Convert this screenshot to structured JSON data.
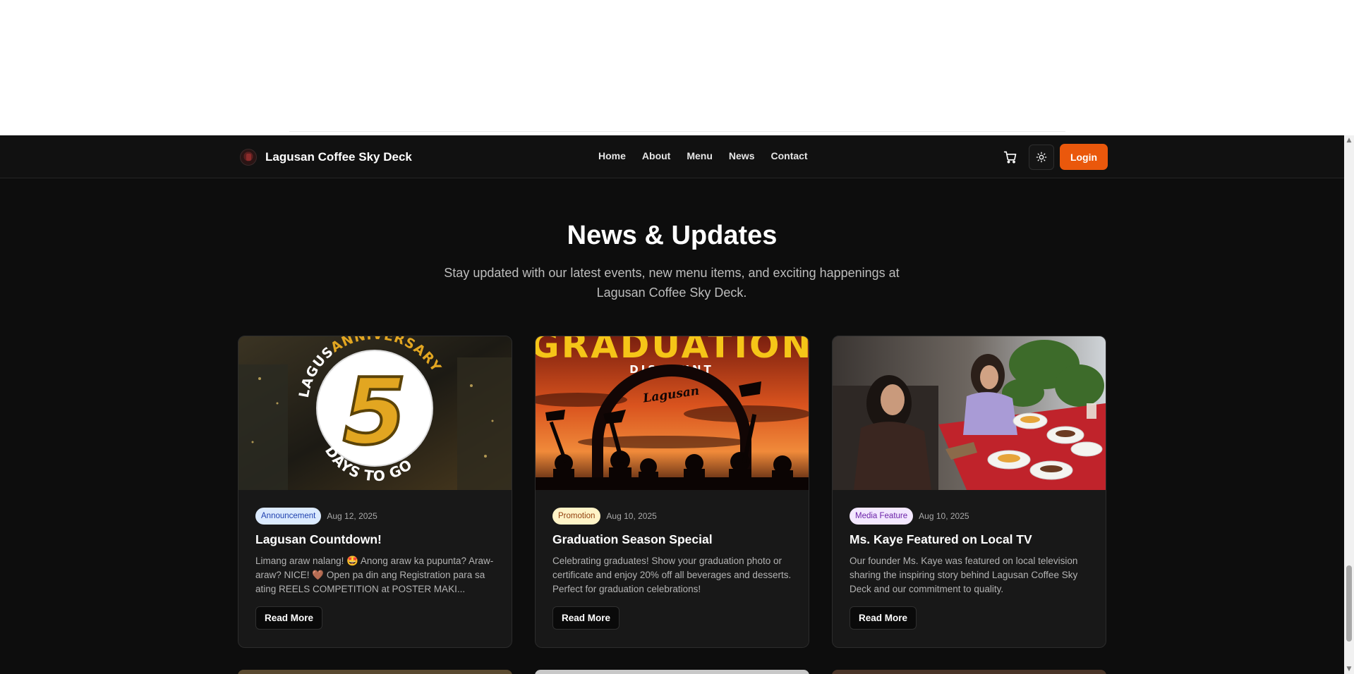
{
  "nav": {
    "brand": "Lagusan Coffee Sky Deck",
    "links": [
      "Home",
      "About",
      "Menu",
      "News",
      "Contact"
    ],
    "login_label": "Login",
    "cart_icon": "cart-icon",
    "theme_icon": "sun-icon"
  },
  "hero": {
    "title": "News & Updates",
    "subtitle": "Stay updated with our latest events, new menu items, and exciting happenings at Lagusan Coffee Sky Deck."
  },
  "cards": [
    {
      "badge": "Announcement",
      "date": "Aug 12, 2025",
      "title": "Lagusan Countdown!",
      "text": "Limang araw nalang! 🤩 Anong araw ka pupunta? Araw-araw? NICE! 🤎 Open pa din ang Registration para sa ating REELS COMPETITION at POSTER MAKI...",
      "button": "Read More",
      "image_text": {
        "arc_top_left": "LAGUS",
        "arc_top_right": "ANNIVERSARY",
        "number": "5",
        "arc_bottom": "DAYS TO GO"
      }
    },
    {
      "badge": "Promotion",
      "date": "Aug 10, 2025",
      "title": "Graduation Season Special",
      "text": "Celebrating graduates! Show your graduation photo or certificate and enjoy 20% off all beverages and desserts. Perfect for graduation celebrations!",
      "button": "Read More",
      "image_text": {
        "headline": "GRADUATION",
        "sub": "DISCOUNT",
        "script": "Lagusan"
      }
    },
    {
      "badge": "Media Feature",
      "date": "Aug 10, 2025",
      "title": "Ms. Kaye Featured on Local TV",
      "text": "Our founder Ms. Kaye was featured on local television sharing the inspiring story behind Lagusan Coffee Sky Deck and our commitment to quality.",
      "button": "Read More"
    }
  ],
  "colors": {
    "accent": "#ea580c",
    "background": "#0d0d0d",
    "card": "#181818",
    "badge_announcement_bg": "#dbeafe",
    "badge_announcement_fg": "#1e40af",
    "badge_promotion_bg": "#fef3c7",
    "badge_promotion_fg": "#92400e",
    "badge_media_bg": "#f3e8ff",
    "badge_media_fg": "#6b21a8"
  }
}
